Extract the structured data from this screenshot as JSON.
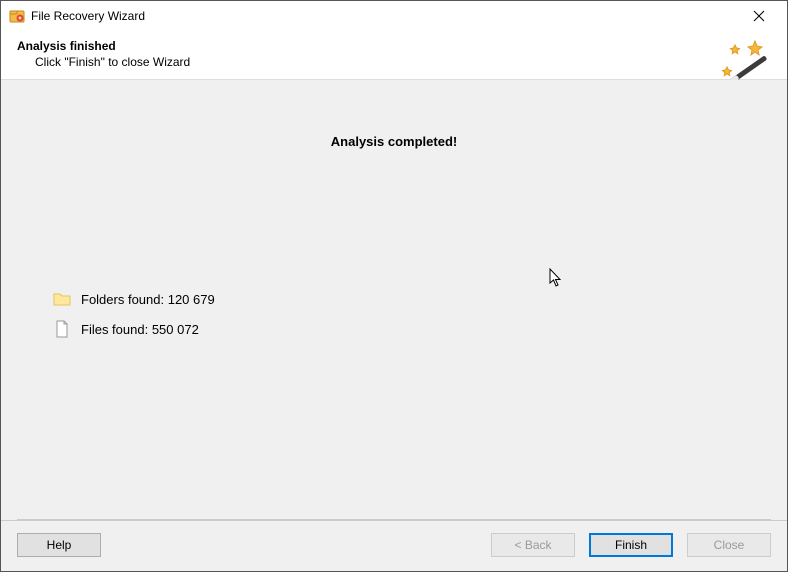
{
  "window": {
    "title": "File Recovery Wizard"
  },
  "header": {
    "title": "Analysis finished",
    "subtitle": "Click \"Finish\" to close Wizard"
  },
  "content": {
    "completed_label": "Analysis completed!",
    "results": [
      {
        "icon": "folder",
        "label": "Folders found: 120 679"
      },
      {
        "icon": "file",
        "label": "Files found: 550 072"
      }
    ]
  },
  "footer": {
    "help_label": "Help",
    "back_label": "< Back",
    "finish_label": "Finish",
    "close_label": "Close"
  }
}
